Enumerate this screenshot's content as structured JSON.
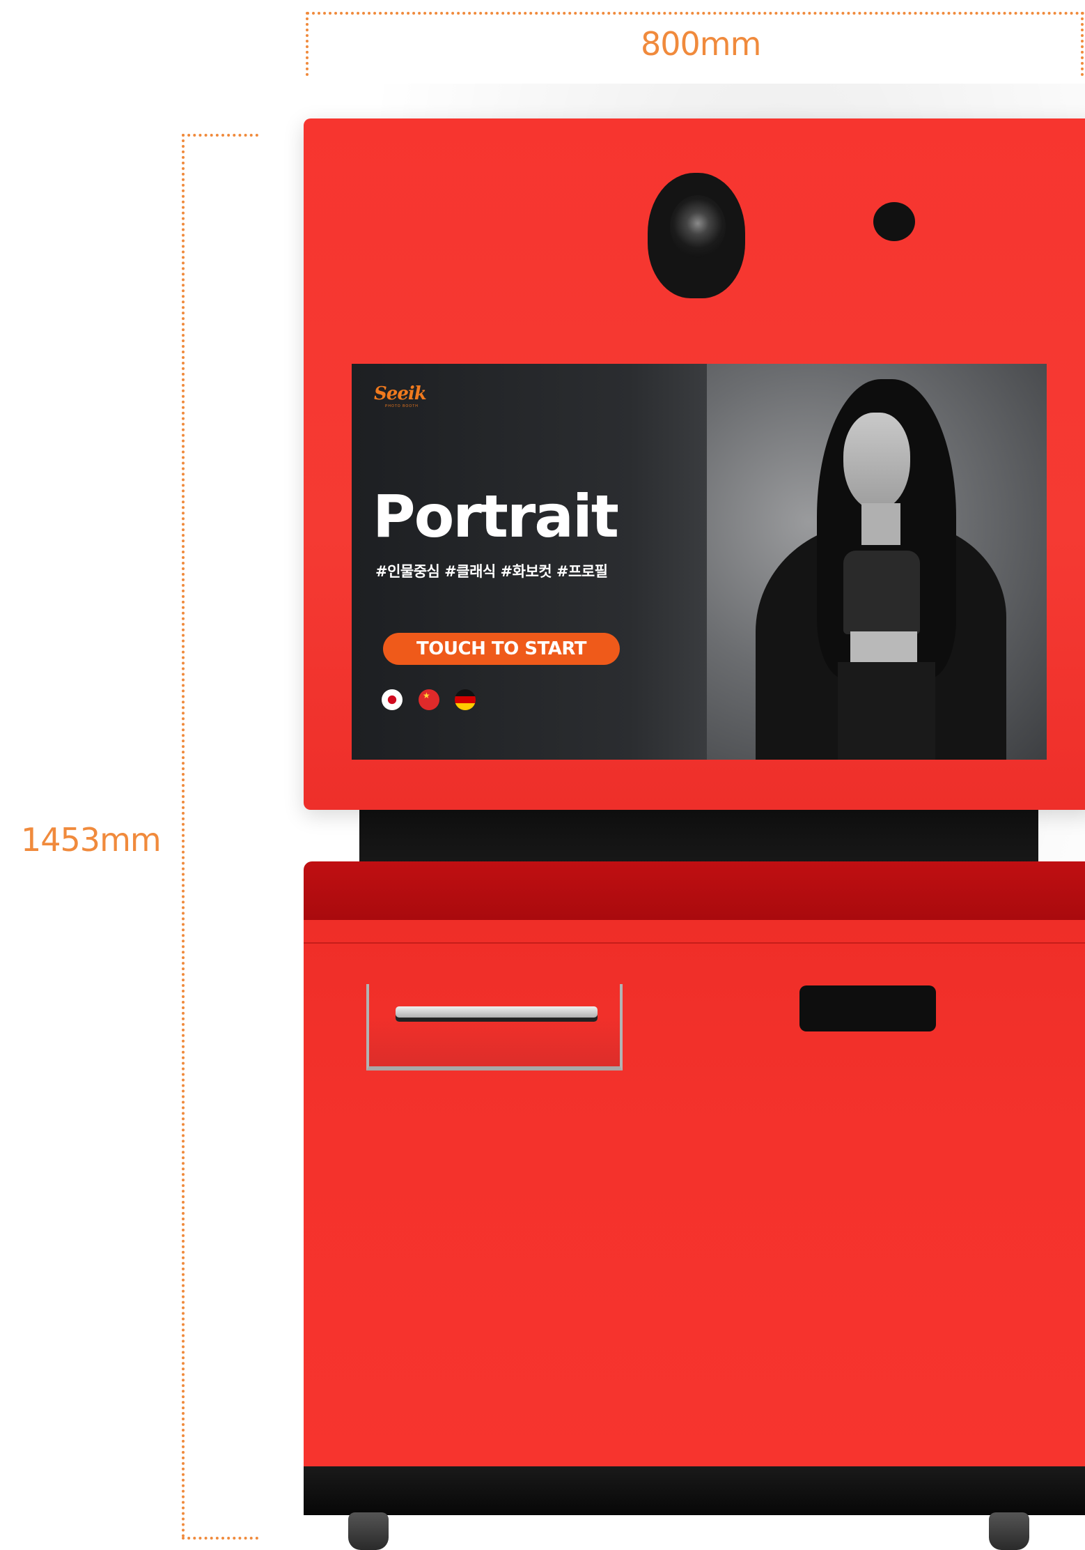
{
  "dimensions": {
    "width_label": "800mm",
    "height_label": "1453mm"
  },
  "screen": {
    "logo": "Seeik",
    "logo_sub": "PHOTO BOOTH",
    "title": "Portrait",
    "tags": "#인물중심 #클래식 #화보컷 #프로필",
    "start_button": "TOUCH TO START",
    "language_flags": [
      "japan-flag-icon",
      "china-flag-icon",
      "germany-flag-icon"
    ]
  },
  "colors": {
    "accent": "#f08a3c",
    "booth_red": "#f5352f",
    "button_orange": "#ef5a1a"
  }
}
